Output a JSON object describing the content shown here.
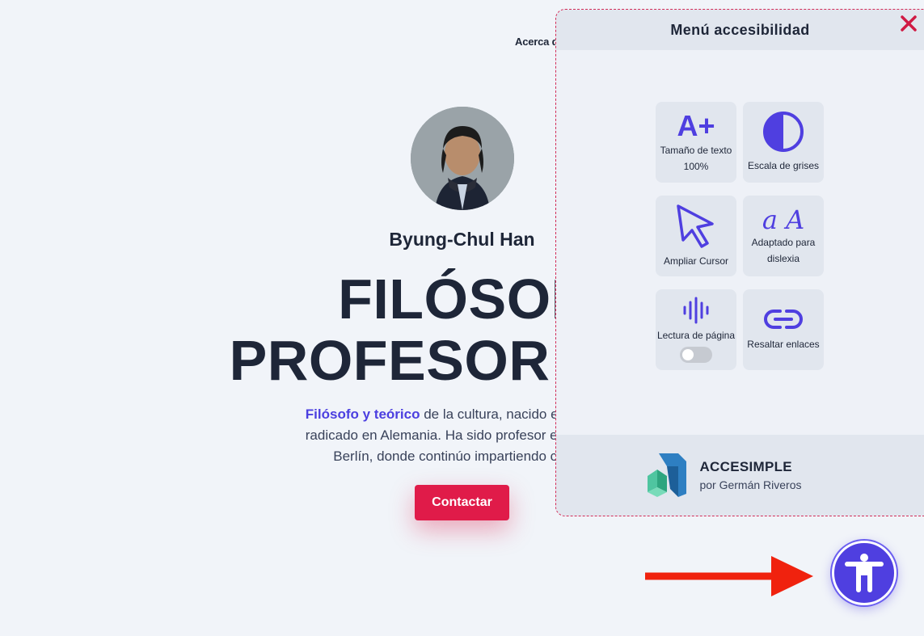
{
  "nav": {
    "about_label": "Acerca d"
  },
  "hero": {
    "name": "Byung-Chul Han",
    "title_line1": "FILÓSOF",
    "title_line2": "PROFESOR Y ES",
    "desc_highlight": "Filósofo y teórico",
    "desc_line1_rest": " de la cultura, nacido en Corea d",
    "desc_line2": "radicado en Alemania. Ha sido profesor en la Unive",
    "desc_line3": "Berlín, donde continúo impartiendo cursos",
    "contact_label": "Contactar"
  },
  "a11y_panel": {
    "title": "Menú accesibilidad",
    "tiles": [
      {
        "icon": "text-size-icon",
        "icon_text": "A+",
        "label": "Tamaño de texto",
        "value": "100%"
      },
      {
        "icon": "grayscale-icon",
        "label": "Escala de grises"
      },
      {
        "icon": "cursor-icon",
        "label": "Ampliar Cursor"
      },
      {
        "icon": "dyslexia-icon",
        "icon_text": "a A",
        "label": "Adaptado para dislexia"
      },
      {
        "icon": "audio-wave-icon",
        "label": "Lectura de página",
        "toggle": "off"
      },
      {
        "icon": "link-icon",
        "label": "Resaltar enlaces"
      }
    ],
    "footer": {
      "brand": "ACCESIMPLE",
      "by": "por Germán Riveros"
    }
  },
  "colors": {
    "accent": "#4f3fe0",
    "danger": "#e01b49",
    "arrow": "#f0220e",
    "background": "#f1f4f9"
  }
}
